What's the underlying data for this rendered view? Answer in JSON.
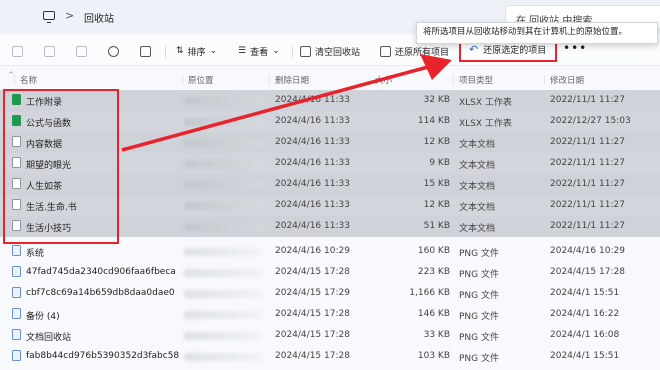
{
  "address": {
    "path": "回收站",
    "separator": ">",
    "search_placeholder": "在 回收站 中搜索"
  },
  "tooltip": "将所选项目从回收站移动到其在计算机上的原始位置。",
  "toolbar": {
    "sort": "排序",
    "view": "查看",
    "empty": "清空回收站",
    "restore_all": "还原所有项目",
    "restore_selected": "还原选定的项目",
    "more": "•••"
  },
  "columns": {
    "name": "名称",
    "origin": "原位置",
    "deleted": "删除日期",
    "size": "大小",
    "type": "项目类型",
    "modified": "修改日期"
  },
  "files": [
    {
      "name": "工作附录",
      "icon": "xlsx",
      "deleted": "2024/4/16 11:33",
      "size": "32 KB",
      "type": "XLSX 工作表",
      "modified": "2022/11/1 11:27",
      "selected": true
    },
    {
      "name": "公式与函数",
      "icon": "xlsx",
      "deleted": "2024/4/16 11:33",
      "size": "114 KB",
      "type": "XLSX 工作表",
      "modified": "2022/12/27 15:03",
      "selected": true
    },
    {
      "name": "内容数据",
      "icon": "txt",
      "deleted": "2024/4/16 11:33",
      "size": "12 KB",
      "type": "文本文档",
      "modified": "2022/11/1 11:27",
      "selected": true
    },
    {
      "name": "期望的眼光",
      "icon": "txt",
      "deleted": "2024/4/16 11:33",
      "size": "9 KB",
      "type": "文本文档",
      "modified": "2022/11/1 11:27",
      "selected": true
    },
    {
      "name": "人生如茶",
      "icon": "txt",
      "deleted": "2024/4/16 11:33",
      "size": "15 KB",
      "type": "文本文档",
      "modified": "2022/11/1 11:27",
      "selected": true
    },
    {
      "name": "生活.生命.书",
      "icon": "txt",
      "deleted": "2024/4/16 11:33",
      "size": "12 KB",
      "type": "文本文档",
      "modified": "2022/11/1 11:27",
      "selected": true
    },
    {
      "name": "生活小技巧",
      "icon": "txt",
      "deleted": "2024/4/16 11:33",
      "size": "51 KB",
      "type": "文本文档",
      "modified": "2022/11/1 11:27",
      "selected": true
    },
    {
      "name": "系统",
      "icon": "png",
      "deleted": "2024/4/16 10:29",
      "size": "160 KB",
      "type": "PNG 文件",
      "modified": "2024/4/16 10:29",
      "selected": false
    },
    {
      "name": "47fad745da2340cd906faa6fbeca",
      "icon": "png",
      "deleted": "2024/4/15 17:28",
      "size": "223 KB",
      "type": "PNG 文件",
      "modified": "2024/4/15 17:28",
      "selected": false
    },
    {
      "name": "cbf7c8c69a14b659db8daa0dae0",
      "icon": "png",
      "deleted": "2024/4/15 17:29",
      "size": "1,166 KB",
      "type": "PNG 文件",
      "modified": "2024/4/1 15:51",
      "selected": false
    },
    {
      "name": "备份 (4)",
      "icon": "png",
      "deleted": "2024/4/15 17:28",
      "size": "146 KB",
      "type": "PNG 文件",
      "modified": "2024/4/1 16:22",
      "selected": false
    },
    {
      "name": "文档回收站",
      "icon": "png",
      "deleted": "2024/4/15 17:28",
      "size": "33 KB",
      "type": "PNG 文件",
      "modified": "2024/4/1 16:08",
      "selected": false
    },
    {
      "name": "fab8b44cd976b5390352d3fabc58",
      "icon": "png",
      "deleted": "2024/4/15 17:28",
      "size": "103 KB",
      "type": "PNG 文件",
      "modified": "2024/4/1 15:51",
      "selected": false
    }
  ]
}
